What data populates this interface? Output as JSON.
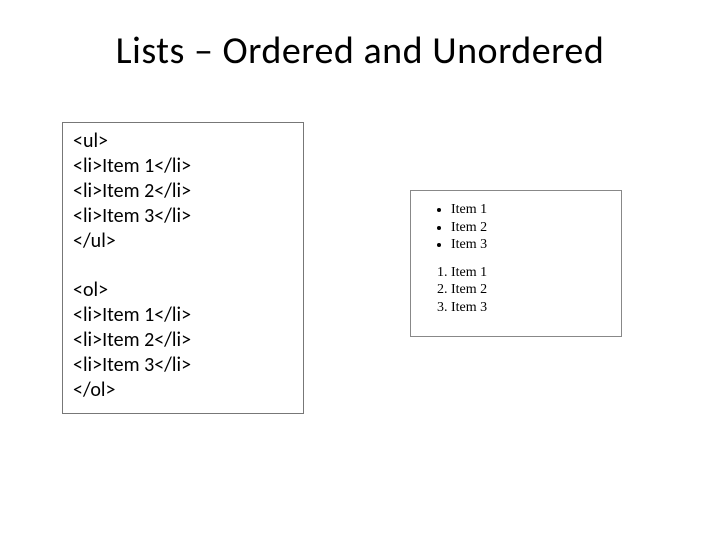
{
  "title": "Lists – Ordered and Unordered",
  "code": {
    "ul_open": "<ul>",
    "ul_li1": "<li>Item 1</li>",
    "ul_li2": "<li>Item 2</li>",
    "ul_li3": "<li>Item 3</li>",
    "ul_close": "</ul>",
    "ol_open": "<ol>",
    "ol_li1": "<li>Item 1</li>",
    "ol_li2": "<li>Item 2</li>",
    "ol_li3": "<li>Item 3</li>",
    "ol_close": "</ol>"
  },
  "rendered": {
    "ul": [
      "Item 1",
      "Item 2",
      "Item 3"
    ],
    "ol": [
      "Item 1",
      "Item 2",
      "Item 3"
    ]
  }
}
